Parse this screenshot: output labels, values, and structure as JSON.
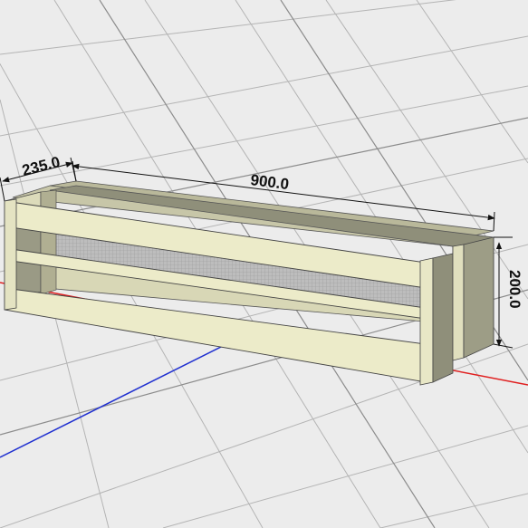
{
  "dimensions": {
    "depth": "235.0",
    "length": "900.0",
    "height": "200.0"
  },
  "colors": {
    "background": "#ececec",
    "grid_line": "#b4b4b4",
    "grid_major": "#8c8c8c",
    "x_axis": "#e02020",
    "y_axis": "#2030d0",
    "wood_light": "#ecebc9",
    "wood_shade": "#b9b89a",
    "wood_dark": "#8f8f7a",
    "mesh": "#b4b4b4",
    "dimension_line": "#111111"
  }
}
